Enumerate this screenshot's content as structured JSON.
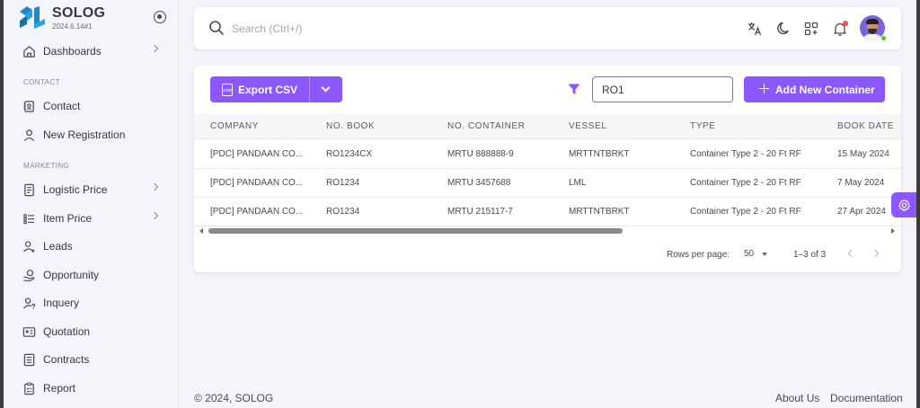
{
  "brand": {
    "name": "SOLOG",
    "version": "2024.6.14#1"
  },
  "sidebar": {
    "items": [
      {
        "label": "Dashboards",
        "icon": "home-icon"
      },
      {
        "label": "Contact",
        "icon": "contact-book-icon"
      },
      {
        "label": "New Registration",
        "icon": "user-icon"
      },
      {
        "label": "Logistic Price",
        "icon": "document-icon"
      },
      {
        "label": "Item Price",
        "icon": "list-icon"
      },
      {
        "label": "Leads",
        "icon": "user-star-icon"
      },
      {
        "label": "Opportunity",
        "icon": "hand-coin-icon"
      },
      {
        "label": "Inquery",
        "icon": "user-question-icon"
      },
      {
        "label": "Quotation",
        "icon": "quote-icon"
      },
      {
        "label": "Contracts",
        "icon": "contract-icon"
      },
      {
        "label": "Report",
        "icon": "clipboard-icon"
      }
    ],
    "sections": {
      "contact": "CONTACT",
      "marketing": "MARKETING"
    }
  },
  "topbar": {
    "search_placeholder": "Search (Ctrl+/)"
  },
  "toolbar": {
    "export_label": "Export CSV",
    "csv_icon_text": "CSV",
    "filter_value": "RO1",
    "add_label": "Add New Container"
  },
  "table": {
    "headers": [
      "COMPANY",
      "NO. BOOK",
      "NO. CONTAINER",
      "VESSEL",
      "TYPE",
      "BOOK DATE"
    ],
    "rows": [
      [
        "[PDC] PANDAAN CO...",
        "RO1234CX",
        "MRTU 888888-9",
        "MRTTNTBRKT",
        "Container Type 2 - 20 Ft RF",
        "15 May 2024"
      ],
      [
        "[PDC] PANDAAN CO...",
        "RO1234",
        "MRTU 3457688",
        "LML",
        "Container Type 2 - 20 Ft RF",
        "7 May 2024"
      ],
      [
        "[PDC] PANDAAN CO...",
        "RO1234",
        "MRTU 215117-7",
        "MRTTNTBRKT",
        "Container Type 2 - 20 Ft RF",
        "27 Apr 2024"
      ]
    ]
  },
  "pagination": {
    "rows_label": "Rows per page:",
    "rows_value": "50",
    "range": "1–3 of 3"
  },
  "footer": {
    "copyright": "© 2024, SOLOG",
    "links": [
      "About Us",
      "Documentation"
    ]
  },
  "colors": {
    "primary": "#8c57ff",
    "background": "#f4f5fa",
    "notification": "#ff4c51",
    "online": "#56ca00"
  }
}
